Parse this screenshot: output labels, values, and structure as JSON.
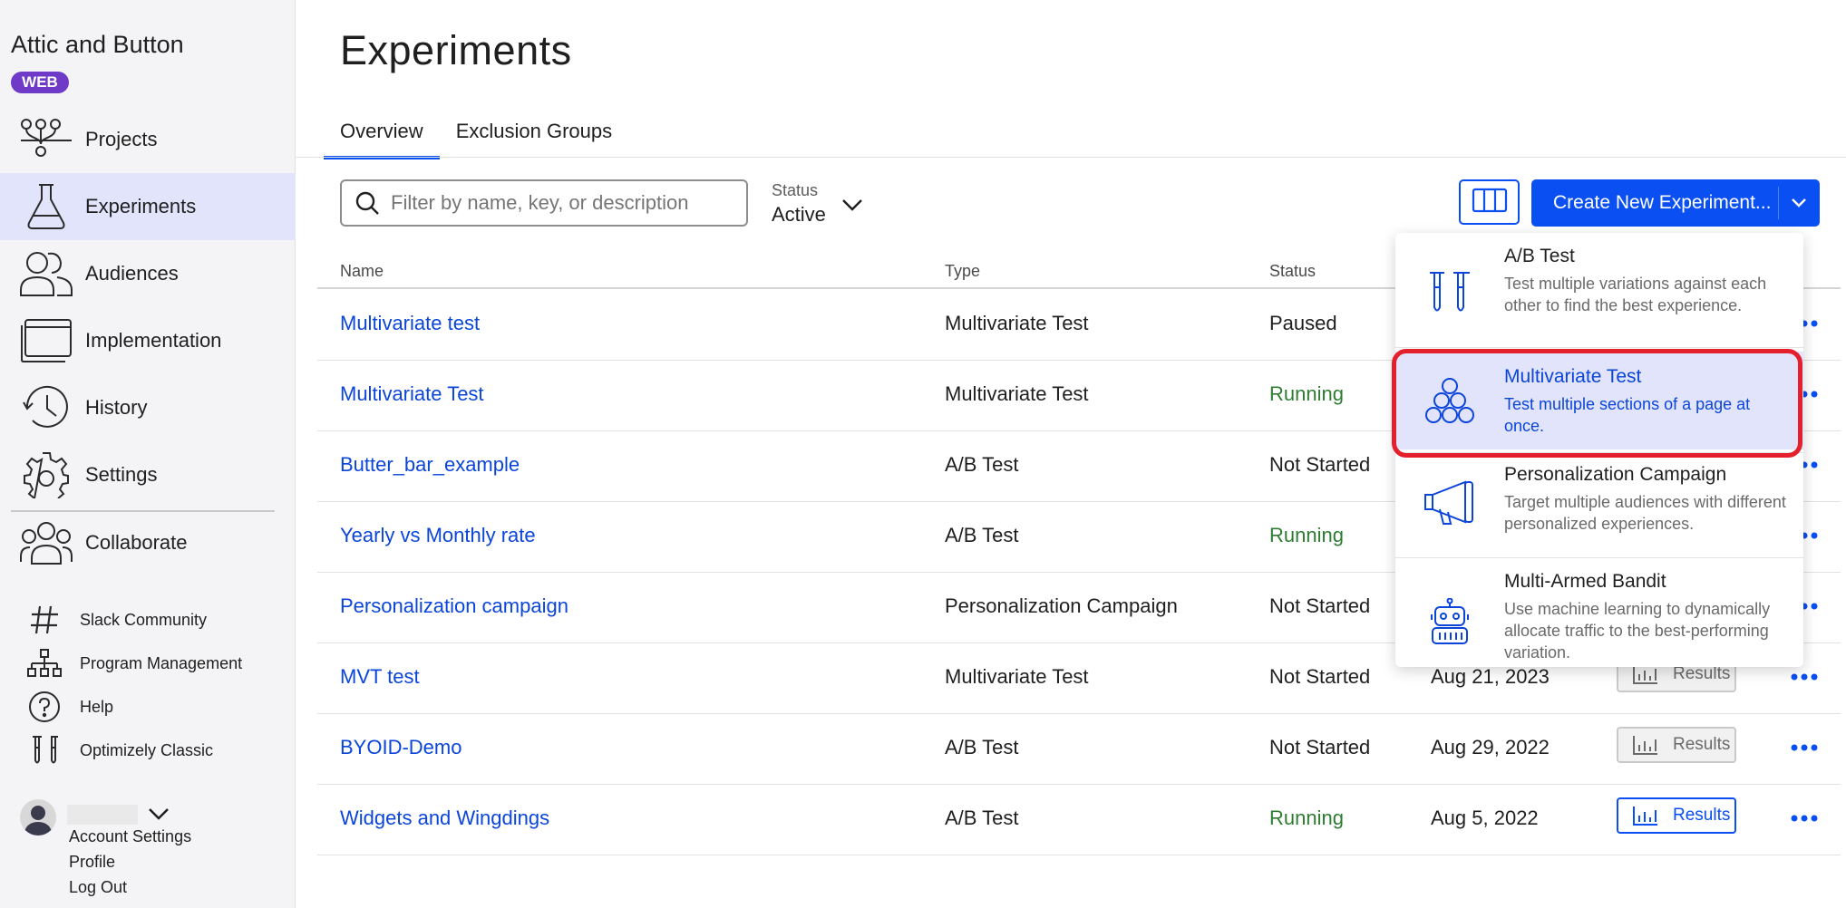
{
  "sidebar": {
    "app_name": "Attic and Button",
    "badge": "WEB",
    "nav": [
      {
        "label": "Projects",
        "icon": "projects-icon"
      },
      {
        "label": "Experiments",
        "icon": "flask-icon",
        "active": true
      },
      {
        "label": "Audiences",
        "icon": "audiences-icon"
      },
      {
        "label": "Implementation",
        "icon": "implementation-icon"
      },
      {
        "label": "History",
        "icon": "history-icon"
      },
      {
        "label": "Settings",
        "icon": "gear-icon"
      },
      {
        "label": "Collaborate",
        "icon": "collaborate-icon"
      }
    ],
    "utility": [
      {
        "label": "Slack Community",
        "icon": "hash-icon"
      },
      {
        "label": "Program Management",
        "icon": "org-chart-icon"
      },
      {
        "label": "Help",
        "icon": "help-icon"
      },
      {
        "label": "Optimizely Classic",
        "icon": "test-tubes-icon"
      }
    ],
    "account": {
      "links": [
        "Account Settings",
        "Profile",
        "Log Out"
      ]
    }
  },
  "main": {
    "title": "Experiments",
    "tabs": [
      {
        "label": "Overview",
        "active": true
      },
      {
        "label": "Exclusion Groups"
      }
    ],
    "search": {
      "placeholder": "Filter by name, key, or description"
    },
    "status_filter": {
      "label": "Status",
      "value": "Active"
    },
    "create_button": "Create New Experiment...",
    "table": {
      "columns": [
        "Name",
        "Type",
        "Status"
      ],
      "rows": [
        {
          "name": "Multivariate test",
          "type": "Multivariate Test",
          "status": "Paused",
          "date": "",
          "results": ""
        },
        {
          "name": "Multivariate Test",
          "type": "Multivariate Test",
          "status": "Running",
          "date": "",
          "results": ""
        },
        {
          "name": "Butter_bar_example",
          "type": "A/B Test",
          "status": "Not Started",
          "date": "",
          "results": ""
        },
        {
          "name": "Yearly vs Monthly rate",
          "type": "A/B Test",
          "status": "Running",
          "date": "",
          "results": ""
        },
        {
          "name": "Personalization campaign",
          "type": "Personalization Campaign",
          "status": "Not Started",
          "date": "",
          "results": ""
        },
        {
          "name": "MVT test",
          "type": "Multivariate Test",
          "status": "Not Started",
          "date": "Aug 21, 2023",
          "results": "Results"
        },
        {
          "name": "BYOID-Demo",
          "type": "A/B Test",
          "status": "Not Started",
          "date": "Aug 29, 2022",
          "results": "Results"
        },
        {
          "name": "Widgets and Wingdings",
          "type": "A/B Test",
          "status": "Running",
          "date": "Aug 5, 2022",
          "results": "Results"
        }
      ]
    }
  },
  "dropdown": {
    "options": [
      {
        "title": "A/B Test",
        "desc": "Test multiple variations against each other to find the best experience.",
        "icon": "test-tubes-icon"
      },
      {
        "title": "Multivariate Test",
        "desc": "Test multiple sections of a page at once.",
        "icon": "circles-icon",
        "selected": true
      },
      {
        "title": "Personalization Campaign",
        "desc": "Target multiple audiences with different personalized experiences.",
        "icon": "megaphone-icon"
      },
      {
        "title": "Multi-Armed Bandit",
        "desc": "Use machine learning to dynamically allocate traffic to the best-performing variation.",
        "icon": "robot-icon"
      }
    ]
  },
  "colors": {
    "accent": "#0a4ff2",
    "link": "#0b45d9",
    "running": "#2e7d32",
    "badge": "#6e3ac7",
    "highlight": "#e4202d",
    "active_nav": "#e1e4fb"
  }
}
